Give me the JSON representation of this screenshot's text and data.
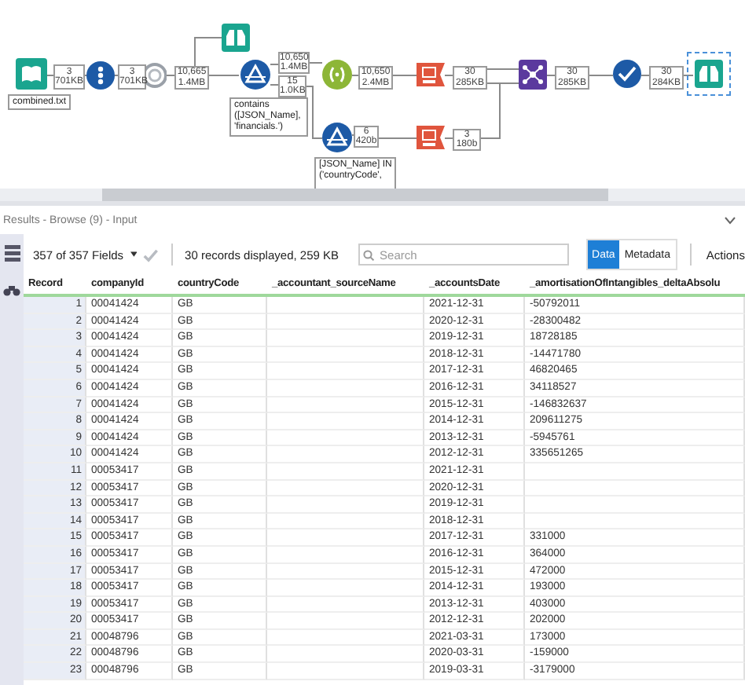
{
  "workflow": {
    "nodes": [
      {
        "kind": "input",
        "selected": false
      },
      {
        "kind": "select",
        "selected": false
      },
      {
        "kind": "cleanse",
        "selected": false
      },
      {
        "kind": "browse",
        "selected": false
      },
      {
        "kind": "filter",
        "selected": false
      },
      {
        "kind": "formula",
        "selected": false
      },
      {
        "kind": "filter",
        "selected": false
      },
      {
        "kind": "json",
        "selected": false
      },
      {
        "kind": "json",
        "selected": false
      },
      {
        "kind": "join",
        "selected": false
      },
      {
        "kind": "check",
        "selected": false
      },
      {
        "kind": "browse",
        "selected": true
      }
    ],
    "counts": [
      {
        "records": "3",
        "size": "701KB"
      },
      {
        "records": "3",
        "size": "701KB"
      },
      {
        "records": "10,665",
        "size": "1.4MB"
      },
      {
        "records": "10,650",
        "size": "1.4MB"
      },
      {
        "records": "15",
        "size": "1.0KB"
      },
      {
        "records": "10,650",
        "size": "2.4MB"
      },
      {
        "records": "6",
        "size": "420b"
      },
      {
        "records": "30",
        "size": "285KB"
      },
      {
        "records": "3",
        "size": "180b"
      },
      {
        "records": "30",
        "size": "285KB"
      },
      {
        "records": "30",
        "size": "284KB"
      }
    ],
    "annotations": [
      "combined.txt",
      "contains\n([JSON_Name],\n'financials.')",
      "[JSON_Name] IN\n('countryCode',"
    ]
  },
  "results": {
    "title": "Results - Browse (9) - Input",
    "fields": "357 of 357 Fields",
    "summary": "30 records displayed, 259 KB",
    "search": {
      "placeholder": "Search"
    },
    "views": [
      {
        "label": "Data",
        "selected": true
      },
      {
        "label": "Metadata",
        "selected": false
      }
    ],
    "actions": "Actions"
  },
  "table": {
    "columns": [
      "Record",
      "companyId",
      "countryCode",
      "_accountant_sourceName",
      "_accountsDate",
      "_amortisationOfIntangibles_deltaAbsolu"
    ],
    "rows": [
      {
        "record": "1",
        "companyId": "00041424",
        "countryCode": "GB",
        "date": "2021-12-31",
        "amort": "-50792011"
      },
      {
        "record": "2",
        "companyId": "00041424",
        "countryCode": "GB",
        "date": "2020-12-31",
        "amort": "-28300482"
      },
      {
        "record": "3",
        "companyId": "00041424",
        "countryCode": "GB",
        "date": "2019-12-31",
        "amort": "18728185"
      },
      {
        "record": "4",
        "companyId": "00041424",
        "countryCode": "GB",
        "date": "2018-12-31",
        "amort": "-14471780"
      },
      {
        "record": "5",
        "companyId": "00041424",
        "countryCode": "GB",
        "date": "2017-12-31",
        "amort": "46820465"
      },
      {
        "record": "6",
        "companyId": "00041424",
        "countryCode": "GB",
        "date": "2016-12-31",
        "amort": "34118527"
      },
      {
        "record": "7",
        "companyId": "00041424",
        "countryCode": "GB",
        "date": "2015-12-31",
        "amort": "-146832637"
      },
      {
        "record": "8",
        "companyId": "00041424",
        "countryCode": "GB",
        "date": "2014-12-31",
        "amort": "209611275"
      },
      {
        "record": "9",
        "companyId": "00041424",
        "countryCode": "GB",
        "date": "2013-12-31",
        "amort": "-5945761"
      },
      {
        "record": "10",
        "companyId": "00041424",
        "countryCode": "GB",
        "date": "2012-12-31",
        "amort": "335651265"
      },
      {
        "record": "11",
        "companyId": "00053417",
        "countryCode": "GB",
        "date": "2021-12-31"
      },
      {
        "record": "12",
        "companyId": "00053417",
        "countryCode": "GB",
        "date": "2020-12-31"
      },
      {
        "record": "13",
        "companyId": "00053417",
        "countryCode": "GB",
        "date": "2019-12-31"
      },
      {
        "record": "14",
        "companyId": "00053417",
        "countryCode": "GB",
        "date": "2018-12-31"
      },
      {
        "record": "15",
        "companyId": "00053417",
        "countryCode": "GB",
        "date": "2017-12-31",
        "amort": "331000"
      },
      {
        "record": "16",
        "companyId": "00053417",
        "countryCode": "GB",
        "date": "2016-12-31",
        "amort": "364000"
      },
      {
        "record": "17",
        "companyId": "00053417",
        "countryCode": "GB",
        "date": "2015-12-31",
        "amort": "472000"
      },
      {
        "record": "18",
        "companyId": "00053417",
        "countryCode": "GB",
        "date": "2014-12-31",
        "amort": "193000"
      },
      {
        "record": "19",
        "companyId": "00053417",
        "countryCode": "GB",
        "date": "2013-12-31",
        "amort": "403000"
      },
      {
        "record": "20",
        "companyId": "00053417",
        "countryCode": "GB",
        "date": "2012-12-31",
        "amort": "202000"
      },
      {
        "record": "21",
        "companyId": "00048796",
        "countryCode": "GB",
        "date": "2021-03-31",
        "amort": "173000"
      },
      {
        "record": "22",
        "companyId": "00048796",
        "countryCode": "GB",
        "date": "2020-03-31",
        "amort": "-159000"
      },
      {
        "record": "23",
        "companyId": "00048796",
        "countryCode": "GB",
        "date": "2019-03-31",
        "amort": "-3179000"
      }
    ]
  }
}
